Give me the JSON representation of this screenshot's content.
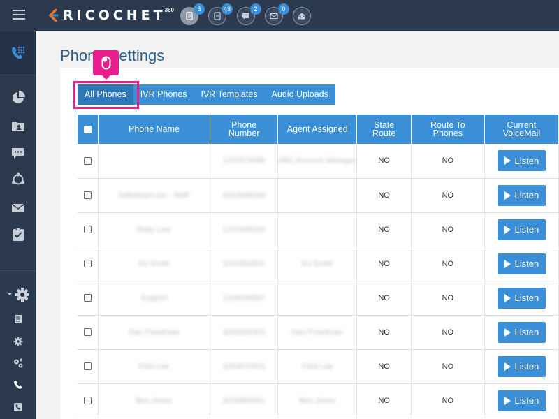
{
  "app": {
    "brand": "RICOCHET",
    "brand_sup": "360",
    "brand_accent": "#e8732a",
    "primary_color": "#3a8fd6",
    "sidebar_color": "#2b3a4e",
    "highlight_color": "#e91e8c"
  },
  "topbar": {
    "icons": [
      {
        "name": "reports-icon",
        "badge": "6"
      },
      {
        "name": "inbox-icon",
        "badge": "43"
      },
      {
        "name": "chat-icon",
        "badge": "2"
      },
      {
        "name": "mail-icon",
        "badge": "0"
      },
      {
        "name": "envelope-open-icon"
      }
    ]
  },
  "sidebar": {
    "items": [
      {
        "name": "phone-keypad-icon"
      },
      {
        "name": "pie-chart-icon"
      },
      {
        "name": "contacts-folder-icon"
      },
      {
        "name": "chat-icon"
      },
      {
        "name": "network-icon"
      },
      {
        "name": "mail-icon"
      },
      {
        "name": "checklist-icon"
      },
      {
        "name": "settings-gear-icon"
      },
      {
        "name": "document-icon"
      },
      {
        "name": "gear-small-icon"
      },
      {
        "name": "gears-icon"
      },
      {
        "name": "phone-icon"
      },
      {
        "name": "phone-card-icon"
      }
    ]
  },
  "page": {
    "title": "Phone Settings"
  },
  "tabs": [
    {
      "label": "All Phones",
      "active": true
    },
    {
      "label": "IVR Phones",
      "active": false
    },
    {
      "label": "IVR Templates",
      "active": false
    },
    {
      "label": "Audio Uploads",
      "active": false
    }
  ],
  "table": {
    "headers": [
      "",
      "Phone Name",
      "Phone Number",
      "Agent Assigned",
      "State Route",
      "Route To Phones",
      "Current VoiceMail"
    ],
    "header_lines": {
      "phone_number": [
        "Phone",
        "Number"
      ],
      "state_route": [
        "State",
        "Route"
      ],
      "route_to_phones": [
        "Route To",
        "Phones"
      ],
      "current_voicemail": [
        "Current",
        "VoiceMail"
      ]
    },
    "listen_label": "Listen",
    "rows": [
      {
        "name": "",
        "number": "1231579086",
        "agent": "ABC Account Manager",
        "state_route": "NO",
        "route_to_phones": "NO"
      },
      {
        "name": "Salesteam.biz - SMP",
        "number": "3203568336",
        "agent": "",
        "state_route": "NO",
        "route_to_phones": "NO"
      },
      {
        "name": "Baby Line",
        "number": "1231586235",
        "agent": "",
        "state_route": "NO",
        "route_to_phones": "NO"
      },
      {
        "name": "Ed Smith",
        "number": "3202583501",
        "agent": "Ed Smith",
        "state_route": "NO",
        "route_to_phones": "NO"
      },
      {
        "name": "Support",
        "number": "1234546597",
        "agent": "",
        "state_route": "NO",
        "route_to_phones": "NO"
      },
      {
        "name": "Dan Freedman",
        "number": "3208265353",
        "agent": "Dan Freedman",
        "state_route": "NO",
        "route_to_phones": "NO"
      },
      {
        "name": "Fred Lee",
        "number": "3204870531",
        "agent": "Fred Lee",
        "state_route": "NO",
        "route_to_phones": "NO"
      },
      {
        "name": "Ben Jones",
        "number": "3202869561",
        "agent": "Ben Jones",
        "state_route": "NO",
        "route_to_phones": "NO"
      }
    ]
  }
}
